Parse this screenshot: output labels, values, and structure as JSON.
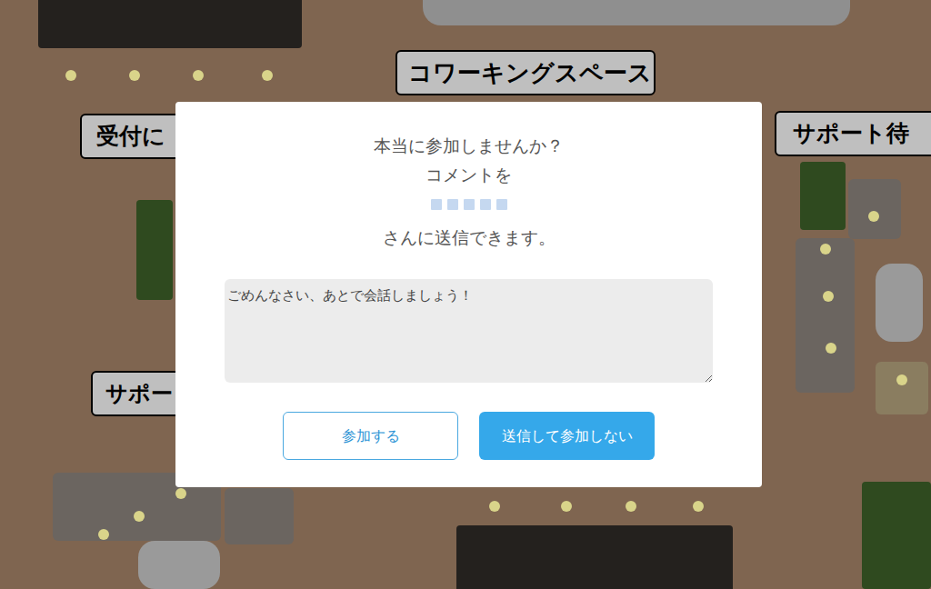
{
  "labels": [
    {
      "text": "コワーキングスペース"
    },
    {
      "text": "受付に"
    },
    {
      "text": "サポート待"
    },
    {
      "text": "サポー"
    }
  ],
  "dialog": {
    "lines": [
      "本当に参加しませんか？",
      "コメントを"
    ],
    "recipient_hidden": true,
    "suffix": "さんに送信できます。",
    "comment": "ごめんなさい、あとで会話しましょう！",
    "buttons": [
      {
        "label": "参加する",
        "kind": "secondary"
      },
      {
        "label": "送信して参加しない",
        "kind": "primary"
      }
    ]
  }
}
